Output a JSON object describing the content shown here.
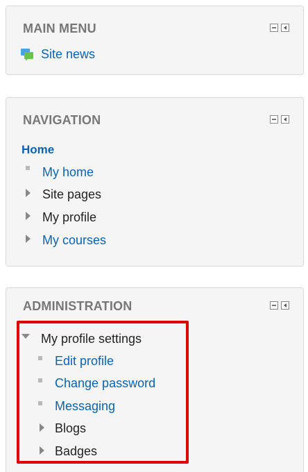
{
  "main_menu": {
    "title": "MAIN MENU",
    "items": [
      {
        "label": "Site news",
        "icon": "forum-icon"
      }
    ]
  },
  "navigation": {
    "title": "NAVIGATION",
    "home": "Home",
    "items": [
      {
        "label": "My home",
        "type": "leaf",
        "link": true
      },
      {
        "label": "Site pages",
        "type": "collapsed",
        "link": false
      },
      {
        "label": "My profile",
        "type": "collapsed",
        "link": false
      },
      {
        "label": "My courses",
        "type": "collapsed",
        "link": true
      }
    ]
  },
  "administration": {
    "title": "ADMINISTRATION",
    "section": "My profile settings",
    "items": [
      {
        "label": "Edit profile",
        "type": "leaf",
        "link": true
      },
      {
        "label": "Change password",
        "type": "leaf",
        "link": true
      },
      {
        "label": "Messaging",
        "type": "leaf",
        "link": true
      },
      {
        "label": "Blogs",
        "type": "collapsed",
        "link": false
      },
      {
        "label": "Badges",
        "type": "collapsed",
        "link": false
      }
    ]
  },
  "colors": {
    "link": "#0a63b0",
    "highlight": "#e00000",
    "title": "#777777"
  }
}
